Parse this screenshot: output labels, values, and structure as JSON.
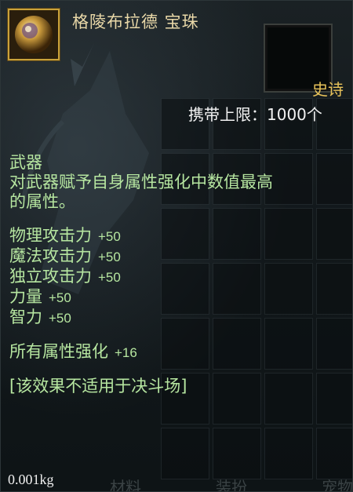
{
  "item": {
    "name": "格陵布拉德 宝珠",
    "rarity": "史诗",
    "carry_limit": "携带上限：1000个",
    "category": "武器",
    "description_line1": "对武器赋予自身属性强化中数值最高",
    "description_line2": "的属性。",
    "stats": [
      {
        "label": "物理攻击力",
        "value": "+50"
      },
      {
        "label": "魔法攻击力",
        "value": "+50"
      },
      {
        "label": "独立攻击力",
        "value": "+50"
      },
      {
        "label": "力量",
        "value": "+50"
      },
      {
        "label": "智力",
        "value": "+50"
      }
    ],
    "element_bonus": {
      "label": "所有属性强化",
      "value": "+16"
    },
    "restriction": "[该效果不适用于决斗场]",
    "weight": "0.001kg"
  },
  "footer": {
    "buttons": [
      "材料",
      "装扮",
      "宠物"
    ]
  },
  "colors": {
    "title": "#e9d8a8",
    "rarity": "#e8c35a",
    "effect_text": "#b6e6a0",
    "icon_border": "#c9a23a"
  },
  "icons": {
    "item_icon": "orb-icon"
  }
}
